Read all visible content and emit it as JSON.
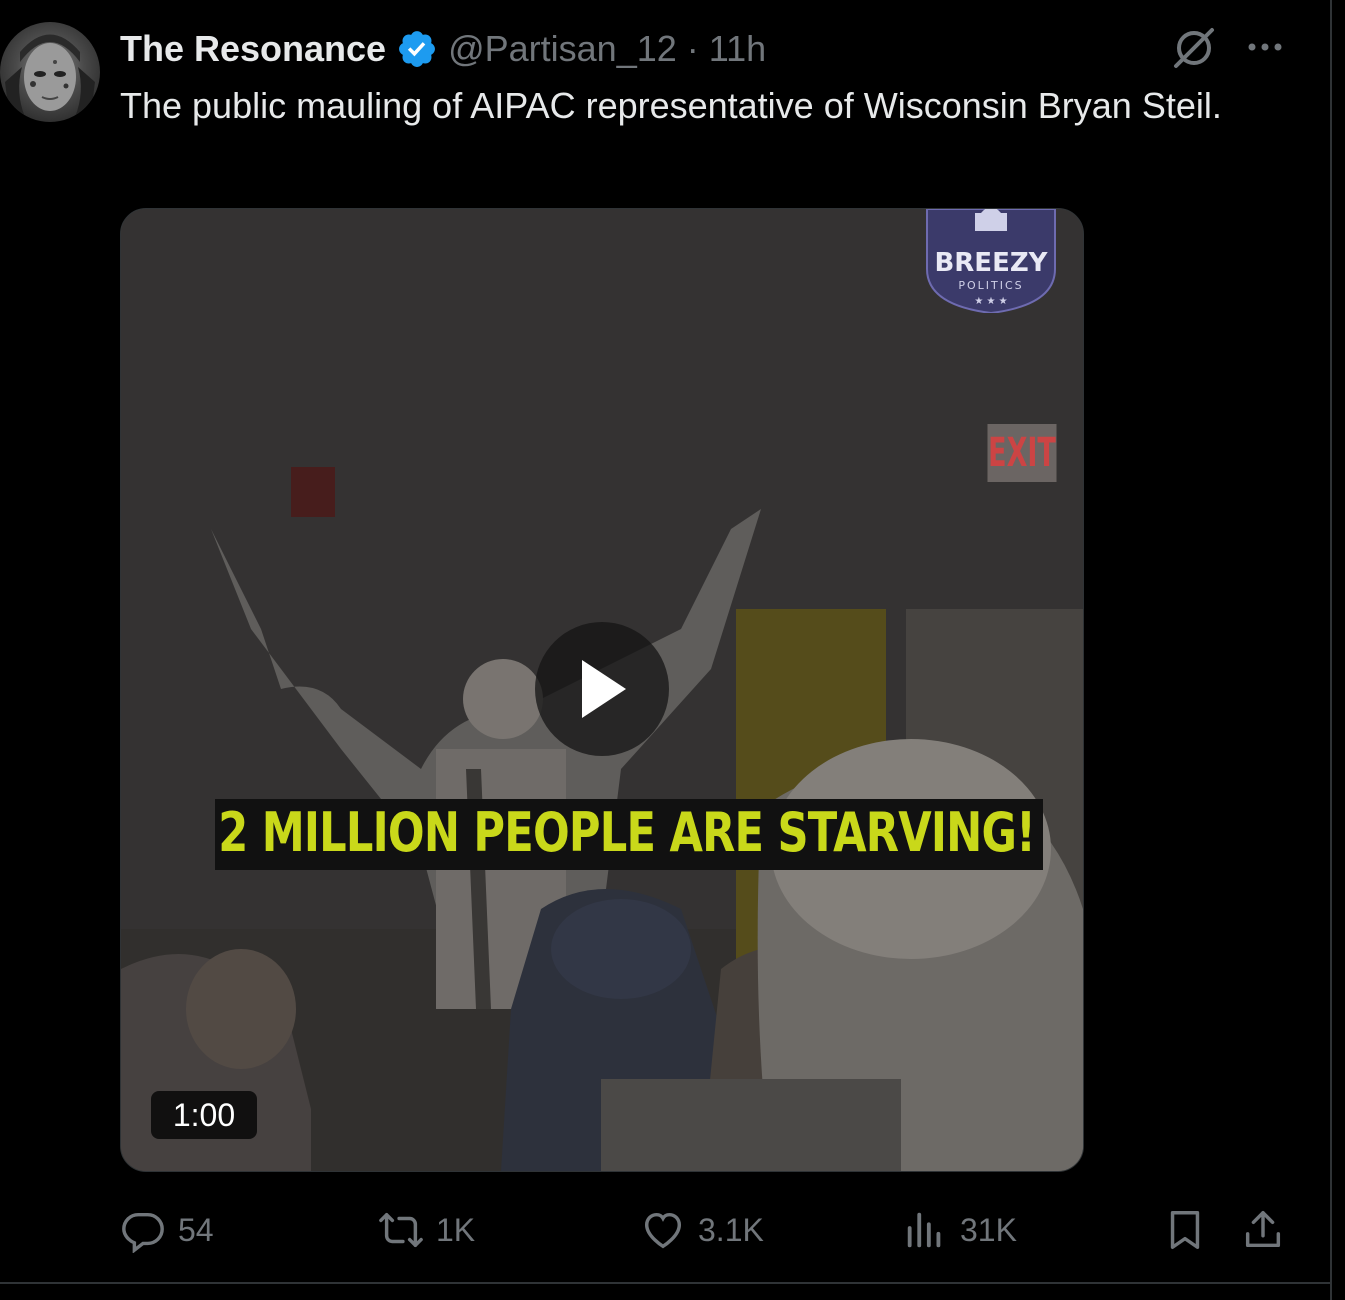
{
  "tweet": {
    "display_name": "The Resonance",
    "handle": "@Partisan_12",
    "separator": "·",
    "time": "11h",
    "text": "The public mauling of AIPAC representative of Wisconsin Bryan Steil."
  },
  "media": {
    "caption": "2 MILLION PEOPLE ARE STARVING!",
    "duration": "1:00",
    "watermark_title": "BREEZY",
    "watermark_subtitle": "POLITICS",
    "sign_text": "EXIT"
  },
  "actions": {
    "replies": "54",
    "reposts": "1K",
    "likes": "3.1K",
    "views": "31K"
  },
  "icons": {
    "verified": "verified-badge-icon",
    "grok": "grok-icon",
    "more": "more-icon",
    "reply": "reply-icon",
    "repost": "repost-icon",
    "like": "like-icon",
    "views": "views-icon",
    "bookmark": "bookmark-icon",
    "share": "share-icon",
    "play": "play-icon"
  },
  "colors": {
    "background": "#000000",
    "text_primary": "#e7e9ea",
    "text_secondary": "#71767b",
    "verified": "#1d9bf0",
    "caption": "#c9d81a"
  }
}
